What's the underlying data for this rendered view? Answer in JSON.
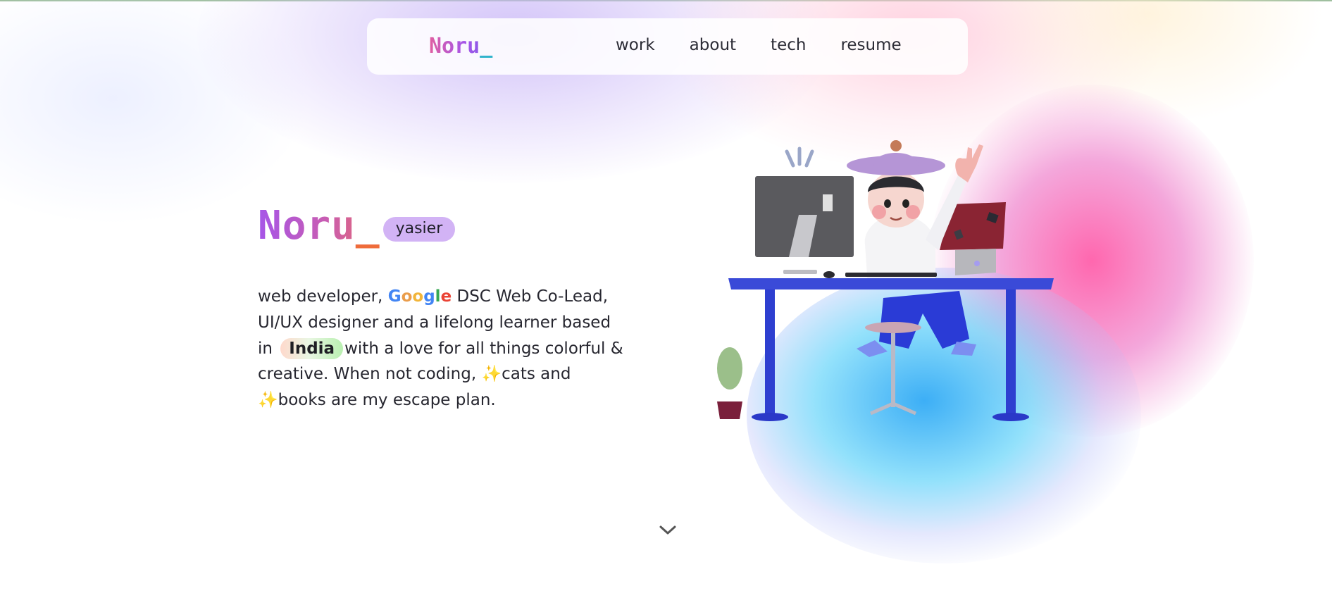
{
  "nav": {
    "logo": {
      "text": "Noru",
      "cursor": "_"
    },
    "links": [
      {
        "label": "work"
      },
      {
        "label": "about"
      },
      {
        "label": "tech"
      },
      {
        "label": "resume"
      }
    ]
  },
  "hero": {
    "title": {
      "text": "Noru",
      "cursor": "_"
    },
    "chip": "yasier",
    "bio": {
      "part1": "web developer, ",
      "google_letters": [
        "G",
        "o",
        "o",
        "g",
        "l",
        "e"
      ],
      "part2": " DSC Web Co-Lead, UI/UX designer and a lifelong learner based in ",
      "country": "India",
      "part3": "with a love for all things colorful & creative. When not coding, ",
      "sparkle": "✨",
      "part4": "cats and ",
      "part5": "books are my escape plan."
    }
  },
  "icons": {
    "scroll_down": "chevron-down-icon",
    "illustration": "developer-at-desk-illustration"
  },
  "colors": {
    "accent_purple": "#a655e8",
    "accent_pink": "#e05fa0",
    "accent_orange": "#ef6c3a",
    "accent_teal": "#27b4c9",
    "chip_bg": "#d2b3f5",
    "blob_pink": "#ff5faa",
    "blob_blue": "#32aaf5"
  }
}
